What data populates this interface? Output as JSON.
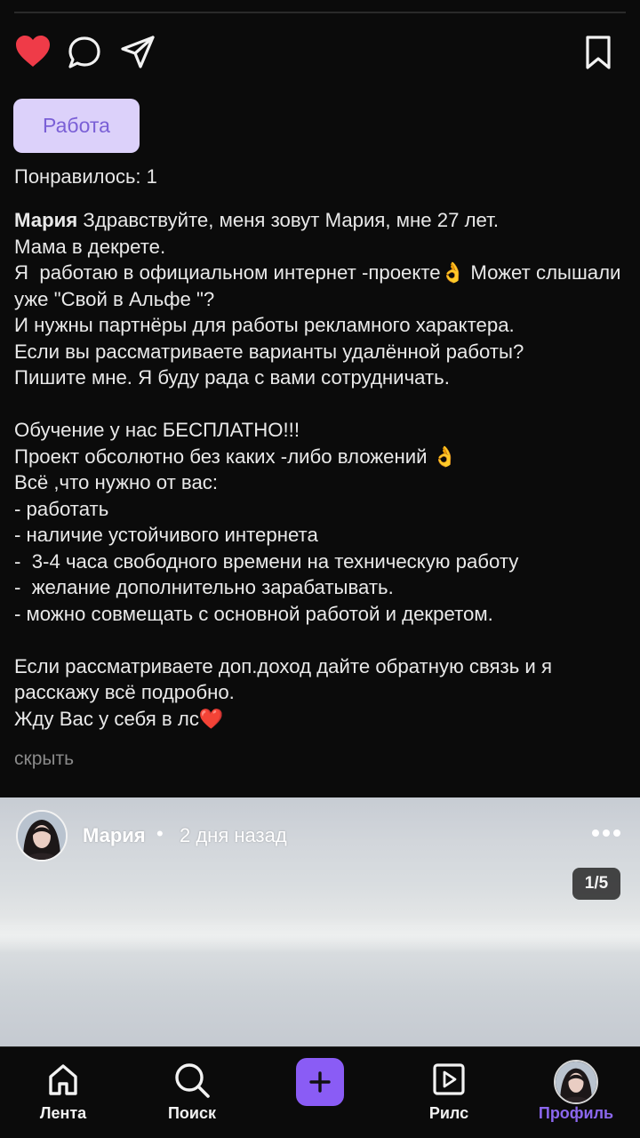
{
  "post": {
    "tag": "Работа",
    "likes_text": "Понравилось: 1",
    "author": "Мария",
    "caption": " Здравствуйте, меня зовут Мария, мне 27 лет.\nМама в декрете.\nЯ  работаю в официальном интернет -проекте👌 Может слышали уже \"Свой в Альфе \"?\nИ нужны партнёры для работы рекламного характера.\nЕсли вы рассматриваете варианты удалённой работы?\nПишите мне. Я буду рада с вами сотрудничать.\n\nОбучение у нас БЕСПЛАТНО!!!\nПроект обсолютно без каких -либо вложений 👌\nВсё ,что нужно от вас:\n- работать\n- наличие устойчивого интернета\n-  3-4 часа свободного времени на техническую работу\n-  желание дополнительно зарабатывать.\n- можно совмещать с основной работой и декретом.\n\nЕсли рассматриваете доп.доход дайте обратную связь и я расскажу всё подробно.\nЖду Вас у себя в лс❤️",
    "hide_label": "скрыть",
    "actions": {
      "like_icon": "heart-filled-icon",
      "like_color": "#ef3b48",
      "comment_icon": "comment-bubble-icon",
      "share_icon": "paper-plane-icon",
      "bookmark_icon": "bookmark-icon"
    }
  },
  "next_post": {
    "author": "Мария",
    "separator": "•",
    "time": "2 дня назад",
    "counter": "1/5",
    "more_icon": "more-dots-icon"
  },
  "nav": {
    "accent": "#8a5cf5",
    "items": [
      {
        "label": "Лента",
        "icon": "home-icon"
      },
      {
        "label": "Поиск",
        "icon": "search-icon"
      },
      {
        "label": "",
        "icon": "plus-icon"
      },
      {
        "label": "Рилс",
        "icon": "reels-icon"
      },
      {
        "label": "Профиль",
        "icon": "avatar"
      }
    ]
  }
}
